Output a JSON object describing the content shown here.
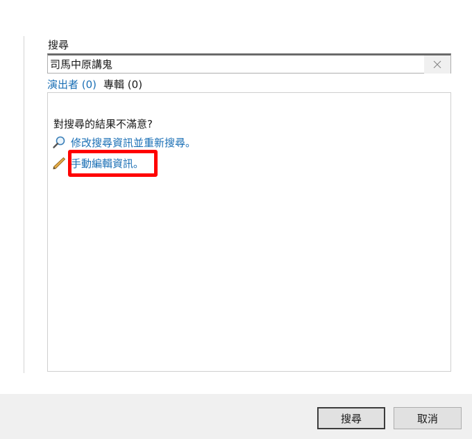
{
  "search": {
    "label": "搜尋",
    "value": "司馬中原講鬼",
    "clear_icon": "close-icon"
  },
  "tabs": {
    "performers": "演出者 (0)",
    "albums": "專輯 (0)"
  },
  "results": {
    "unsatisfied_text": "對搜尋的結果不滿意?",
    "actions": [
      {
        "icon": "magnifier-icon",
        "label": "修改搜尋資訊並重新搜尋。"
      },
      {
        "icon": "pencil-icon",
        "label": "手動編輯資訊。"
      }
    ]
  },
  "highlight_color": "#ff0000",
  "link_color": "#1a6fb5",
  "footer": {
    "search_button": "搜尋",
    "cancel_button": "取消"
  }
}
